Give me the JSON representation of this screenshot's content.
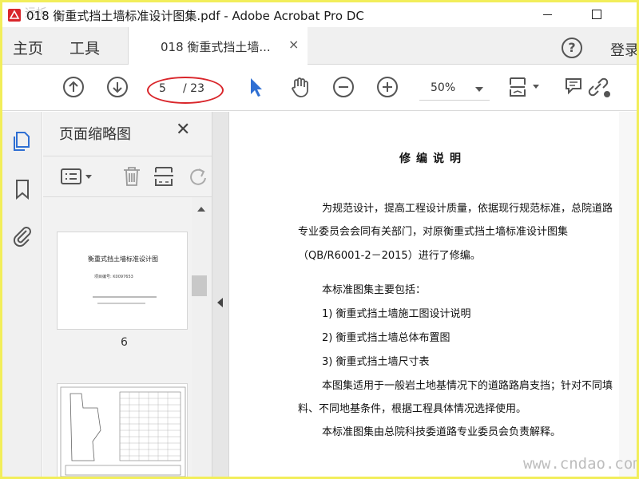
{
  "window": {
    "title": "018 衡重式挡土墙标准设计图集.pdf - Adobe Acrobat Pro DC",
    "corner_watermark": "远析"
  },
  "tabbar": {
    "home_label": "主页",
    "tools_label": "工具",
    "doc_tab_label": "018 衡重式挡土墙...",
    "doc_tab_close": "×",
    "help_glyph": "?",
    "signin_label": "登录"
  },
  "toolbar": {
    "page_current": "5",
    "page_total": "/ 23",
    "zoom": "50%",
    "icons": [
      "prev-page-icon",
      "next-page-icon",
      "select-cursor-icon",
      "hand-tool-icon",
      "zoom-out-icon",
      "zoom-in-icon",
      "fit-page-icon",
      "comment-icon",
      "share-link-icon"
    ]
  },
  "leftrail": {
    "icons": [
      "page-thumbnails-icon",
      "bookmark-icon",
      "attachment-icon"
    ]
  },
  "thumbnails": {
    "title": "页面缩略图",
    "close": "✕",
    "pages": [
      {
        "title": "衡重式挡土墙标准设计图",
        "subtitle": "项目编号: K0097653",
        "number": "6"
      },
      {
        "number": ""
      }
    ]
  },
  "document": {
    "heading": "修编说明",
    "lines": [
      "为规范设计，提高工程设计质量，依据现行规范标准，总院道路",
      "专业委员会会同有关部门，对原衡重式挡土墙标准设计图集",
      "（QB/R6001-2－2015）进行了修编。",
      "本标准图集主要包括：",
      "1) 衡重式挡土墙施工图设计说明",
      "2) 衡重式挡土墙总体布置图",
      "3) 衡重式挡土墙尺寸表",
      "本图集适用于一般岩土地基情况下的道路路肩支挡；针对不同填",
      "料、不同地基条件，根据工程具体情况选择使用。",
      "本标准图集由总院科技委道路专业委员会负责解释。"
    ]
  },
  "watermark": "www.cndao.com",
  "colors": {
    "accent_blue": "#2f6fd3",
    "annotation_red": "#d9262b",
    "screen_border": "#f2ee5a",
    "icon_gray": "#555555"
  }
}
